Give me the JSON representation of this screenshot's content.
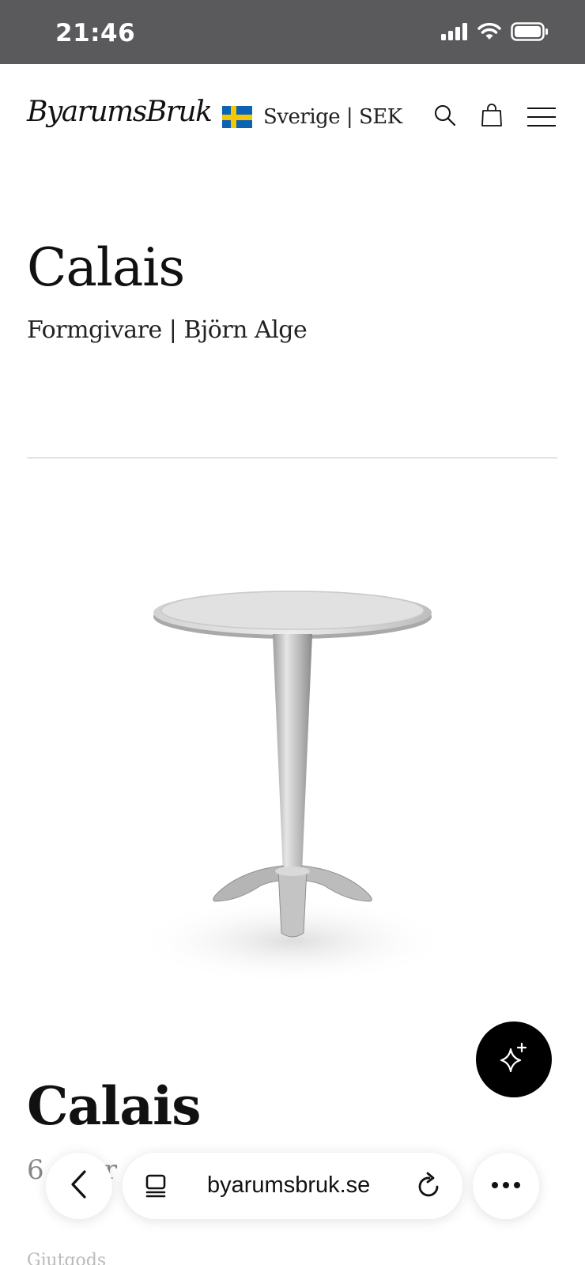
{
  "status_bar": {
    "time": "21:46",
    "icons": [
      "cellular-signal-icon",
      "wifi-icon",
      "battery-icon"
    ]
  },
  "header": {
    "logo_text": "ByarumsBruk",
    "region": {
      "flag": "sweden-flag-icon",
      "label": "Sverige | SEK"
    },
    "icons": [
      "search-icon",
      "shopping-bag-icon",
      "hamburger-menu-icon"
    ]
  },
  "product": {
    "title": "Calais",
    "designer": "Formgivare | Björn Alge",
    "image_alt": "Calais aluminium café table",
    "title_repeat": "Calais",
    "price": "6 … kr",
    "material": "Gjutgods"
  },
  "floating_button": {
    "icon": "sparkles-icon"
  },
  "browser_bar": {
    "url": "byarumsbruk.se",
    "icons": [
      "chevron-left-icon",
      "tabs-icon",
      "reload-icon",
      "more-dots-icon"
    ]
  },
  "colors": {
    "status_bar_bg": "#5a595b",
    "flag_blue": "#0a63b3",
    "flag_yellow": "#f7c600",
    "ai_button_bg": "#000000"
  }
}
